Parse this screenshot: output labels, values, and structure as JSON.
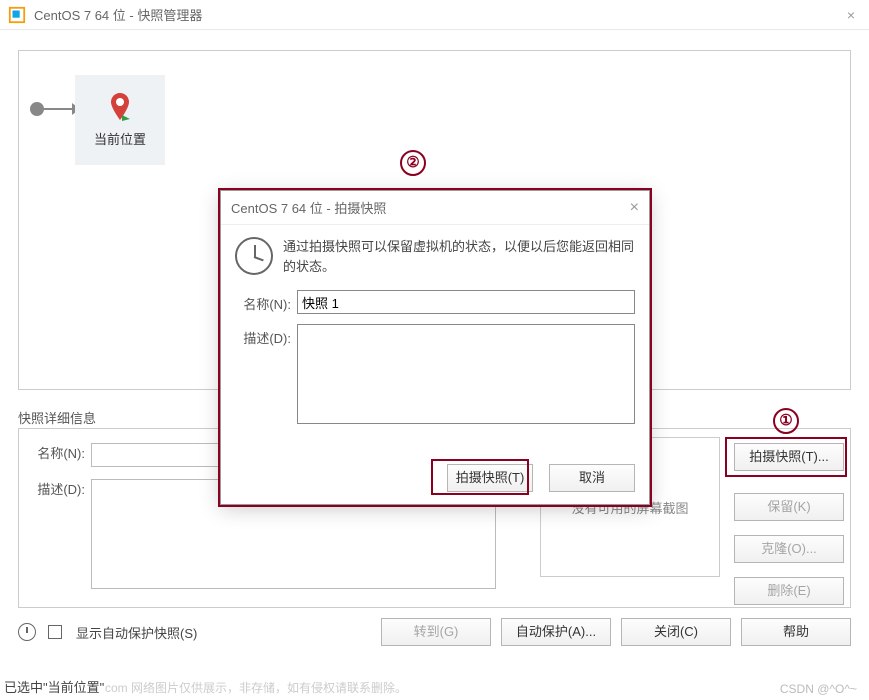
{
  "window": {
    "title": "CentOS 7 64 位 - 快照管理器"
  },
  "tree": {
    "current_label": "当前位置"
  },
  "detail": {
    "section_title": "快照详细信息",
    "name_label": "名称(N):",
    "desc_label": "描述(D):",
    "thumb_text": "没有可用的屏幕截图"
  },
  "side_buttons": {
    "take": "拍摄快照(T)...",
    "keep": "保留(K)",
    "clone": "克隆(O)...",
    "delete": "删除(E)"
  },
  "bottom": {
    "autoprotect_checkbox": "显示自动保护快照(S)",
    "goto": "转到(G)",
    "autoprotect": "自动保护(A)...",
    "close": "关闭(C)",
    "help": "帮助"
  },
  "status": "已选中\"当前位置\"",
  "watermark_left": "com 网络图片仅供展示，非存储，如有侵权请联系删除。",
  "watermark_right": "CSDN @^O^~",
  "modal": {
    "title": "CentOS 7 64 位 - 拍摄快照",
    "info": "通过拍摄快照可以保留虚拟机的状态，以便以后您能返回相同的状态。",
    "name_label": "名称(N):",
    "name_value": "快照 1",
    "desc_label": "描述(D):",
    "desc_value": "",
    "take_btn": "拍摄快照(T)",
    "cancel_btn": "取消"
  },
  "annotations": {
    "one": "①",
    "two": "②"
  }
}
